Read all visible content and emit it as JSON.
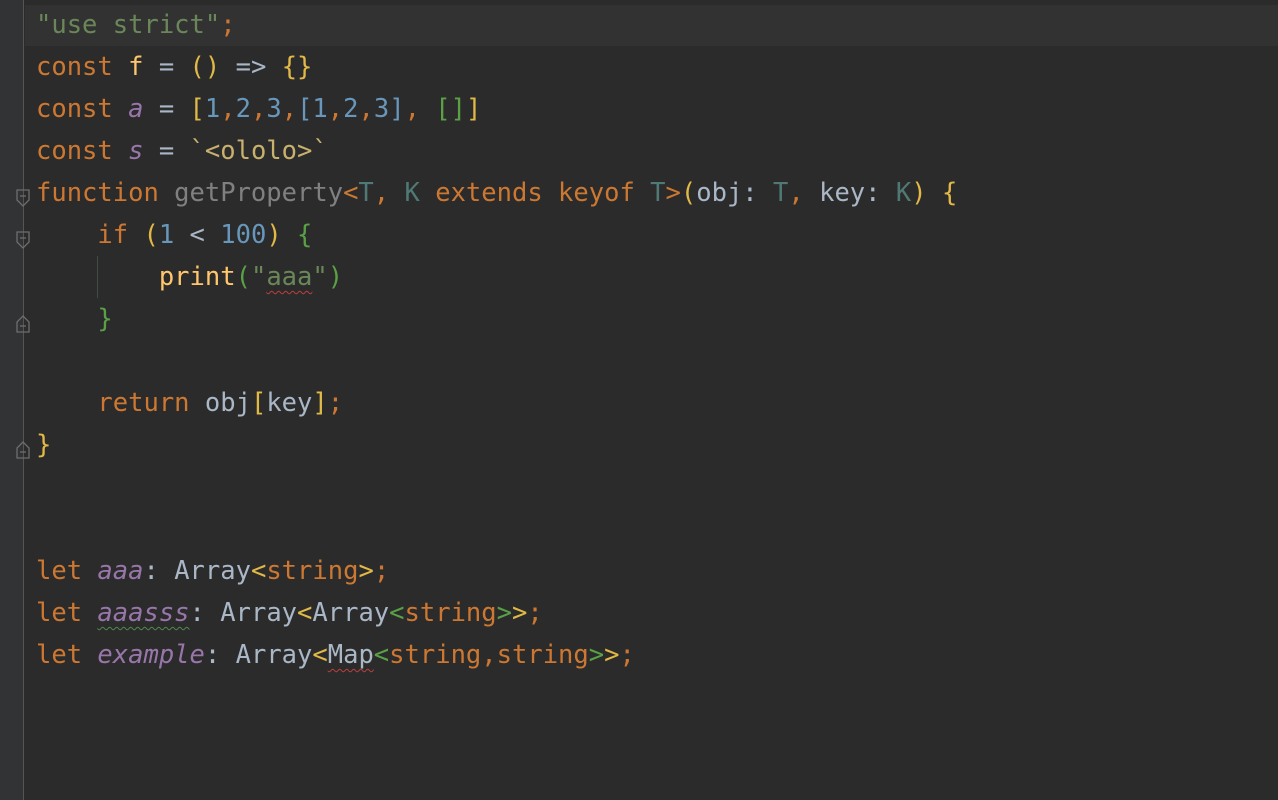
{
  "editor": {
    "language": "TypeScript",
    "colors": {
      "background": "#2b2b2b",
      "keyword": "#cc7832",
      "string": "#6a8759",
      "number": "#6897bb",
      "function_call": "#ffc66d",
      "variable_italic": "#9876aa",
      "type_param": "#507874",
      "plain": "#a9b7c6"
    },
    "lines": [
      {
        "tokens": [
          {
            "text": "\"use strict\"",
            "kind": "string"
          },
          {
            "text": ";",
            "kind": "keyword"
          }
        ]
      },
      {
        "tokens": [
          {
            "text": "const ",
            "kind": "keyword"
          },
          {
            "text": "f",
            "kind": "function"
          },
          {
            "text": " = ",
            "kind": "plain"
          },
          {
            "text": "()",
            "kind": "bracket-gold"
          },
          {
            "text": " => ",
            "kind": "plain"
          },
          {
            "text": "{}",
            "kind": "bracket-gold"
          }
        ]
      },
      {
        "tokens": [
          {
            "text": "const ",
            "kind": "keyword"
          },
          {
            "text": "a",
            "kind": "variable"
          },
          {
            "text": " = ",
            "kind": "plain"
          },
          {
            "text": "[",
            "kind": "bracket-gold"
          },
          {
            "text": "1",
            "kind": "number"
          },
          {
            "text": ",",
            "kind": "keyword"
          },
          {
            "text": "2",
            "kind": "number"
          },
          {
            "text": ",",
            "kind": "keyword"
          },
          {
            "text": "3",
            "kind": "number"
          },
          {
            "text": ",",
            "kind": "keyword"
          },
          {
            "text": "[",
            "kind": "bracket-blue"
          },
          {
            "text": "1",
            "kind": "number"
          },
          {
            "text": ",",
            "kind": "keyword"
          },
          {
            "text": "2",
            "kind": "number"
          },
          {
            "text": ",",
            "kind": "keyword"
          },
          {
            "text": "3",
            "kind": "number"
          },
          {
            "text": "]",
            "kind": "bracket-blue"
          },
          {
            "text": ", ",
            "kind": "keyword"
          },
          {
            "text": "[]",
            "kind": "bracket-green"
          },
          {
            "text": "]",
            "kind": "bracket-gold"
          }
        ]
      },
      {
        "tokens": [
          {
            "text": "const ",
            "kind": "keyword"
          },
          {
            "text": "s",
            "kind": "variable"
          },
          {
            "text": " = ",
            "kind": "plain"
          },
          {
            "text": "`<ololo>`",
            "kind": "template"
          }
        ]
      },
      {
        "tokens": [
          {
            "text": "function ",
            "kind": "keyword"
          },
          {
            "text": "getProperty",
            "kind": "declaration"
          },
          {
            "text": "<",
            "kind": "bracket-gold-kw"
          },
          {
            "text": "T",
            "kind": "type-param"
          },
          {
            "text": ", ",
            "kind": "keyword"
          },
          {
            "text": "K",
            "kind": "type-param"
          },
          {
            "text": " extends keyof ",
            "kind": "keyword"
          },
          {
            "text": "T",
            "kind": "type-param"
          },
          {
            "text": ">",
            "kind": "bracket-gold-kw"
          },
          {
            "text": "(",
            "kind": "bracket-gold"
          },
          {
            "text": "obj",
            "kind": "plain"
          },
          {
            "text": ": ",
            "kind": "plain"
          },
          {
            "text": "T",
            "kind": "type-param"
          },
          {
            "text": ", ",
            "kind": "keyword"
          },
          {
            "text": "key",
            "kind": "plain"
          },
          {
            "text": ": ",
            "kind": "plain"
          },
          {
            "text": "K",
            "kind": "type-param"
          },
          {
            "text": ")",
            "kind": "bracket-gold"
          },
          {
            "text": " ",
            "kind": "plain"
          },
          {
            "text": "{",
            "kind": "bracket-gold"
          }
        ]
      },
      {
        "tokens": [
          {
            "text": "    ",
            "kind": "plain"
          },
          {
            "text": "if ",
            "kind": "keyword"
          },
          {
            "text": "(",
            "kind": "bracket-gold"
          },
          {
            "text": "1",
            "kind": "number"
          },
          {
            "text": " < ",
            "kind": "plain"
          },
          {
            "text": "100",
            "kind": "number"
          },
          {
            "text": ")",
            "kind": "bracket-gold"
          },
          {
            "text": " ",
            "kind": "plain"
          },
          {
            "text": "{",
            "kind": "bracket-green"
          }
        ]
      },
      {
        "tokens": [
          {
            "text": "        ",
            "kind": "plain"
          },
          {
            "text": "print",
            "kind": "function"
          },
          {
            "text": "(",
            "kind": "bracket-green"
          },
          {
            "text": "\"",
            "kind": "string"
          },
          {
            "text": "aaa",
            "kind": "string-typo"
          },
          {
            "text": "\"",
            "kind": "string"
          },
          {
            "text": ")",
            "kind": "bracket-green"
          }
        ]
      },
      {
        "tokens": [
          {
            "text": "    ",
            "kind": "plain"
          },
          {
            "text": "}",
            "kind": "bracket-green"
          }
        ]
      },
      {
        "tokens": []
      },
      {
        "tokens": [
          {
            "text": "    ",
            "kind": "plain"
          },
          {
            "text": "return ",
            "kind": "keyword"
          },
          {
            "text": "obj",
            "kind": "plain"
          },
          {
            "text": "[",
            "kind": "bracket-gold"
          },
          {
            "text": "key",
            "kind": "plain"
          },
          {
            "text": "]",
            "kind": "bracket-gold"
          },
          {
            "text": ";",
            "kind": "keyword"
          }
        ]
      },
      {
        "tokens": [
          {
            "text": "}",
            "kind": "bracket-gold"
          }
        ]
      },
      {
        "tokens": []
      },
      {
        "tokens": []
      },
      {
        "tokens": [
          {
            "text": "let ",
            "kind": "keyword"
          },
          {
            "text": "aaa",
            "kind": "variable"
          },
          {
            "text": ": ",
            "kind": "plain"
          },
          {
            "text": "Array",
            "kind": "plain"
          },
          {
            "text": "<",
            "kind": "bracket-gold"
          },
          {
            "text": "string",
            "kind": "keyword"
          },
          {
            "text": ">",
            "kind": "bracket-gold"
          },
          {
            "text": ";",
            "kind": "keyword"
          }
        ]
      },
      {
        "tokens": [
          {
            "text": "let ",
            "kind": "keyword"
          },
          {
            "text": "aaasss",
            "kind": "variable-unused"
          },
          {
            "text": ": ",
            "kind": "plain"
          },
          {
            "text": "Array",
            "kind": "plain"
          },
          {
            "text": "<",
            "kind": "bracket-gold"
          },
          {
            "text": "Array",
            "kind": "plain"
          },
          {
            "text": "<",
            "kind": "bracket-green"
          },
          {
            "text": "string",
            "kind": "keyword"
          },
          {
            "text": ">",
            "kind": "bracket-green"
          },
          {
            "text": ">",
            "kind": "bracket-gold"
          },
          {
            "text": ";",
            "kind": "keyword"
          }
        ]
      },
      {
        "tokens": [
          {
            "text": "let ",
            "kind": "keyword"
          },
          {
            "text": "example",
            "kind": "variable"
          },
          {
            "text": ": ",
            "kind": "plain"
          },
          {
            "text": "Array",
            "kind": "plain"
          },
          {
            "text": "<",
            "kind": "bracket-gold"
          },
          {
            "text": "Map",
            "kind": "plain-typo"
          },
          {
            "text": "<",
            "kind": "bracket-green"
          },
          {
            "text": "string",
            "kind": "keyword"
          },
          {
            "text": ",",
            "kind": "keyword"
          },
          {
            "text": "string",
            "kind": "keyword"
          },
          {
            "text": ">",
            "kind": "bracket-green"
          },
          {
            "text": ">",
            "kind": "bracket-gold"
          },
          {
            "text": ";",
            "kind": "keyword"
          }
        ]
      }
    ],
    "fold_markers": [
      {
        "line": 4,
        "kind": "open",
        "icon": "fold-open-icon"
      },
      {
        "line": 5,
        "kind": "open",
        "icon": "fold-open-icon"
      },
      {
        "line": 7,
        "kind": "close",
        "icon": "fold-close-icon"
      },
      {
        "line": 10,
        "kind": "close",
        "icon": "fold-close-icon"
      }
    ]
  }
}
